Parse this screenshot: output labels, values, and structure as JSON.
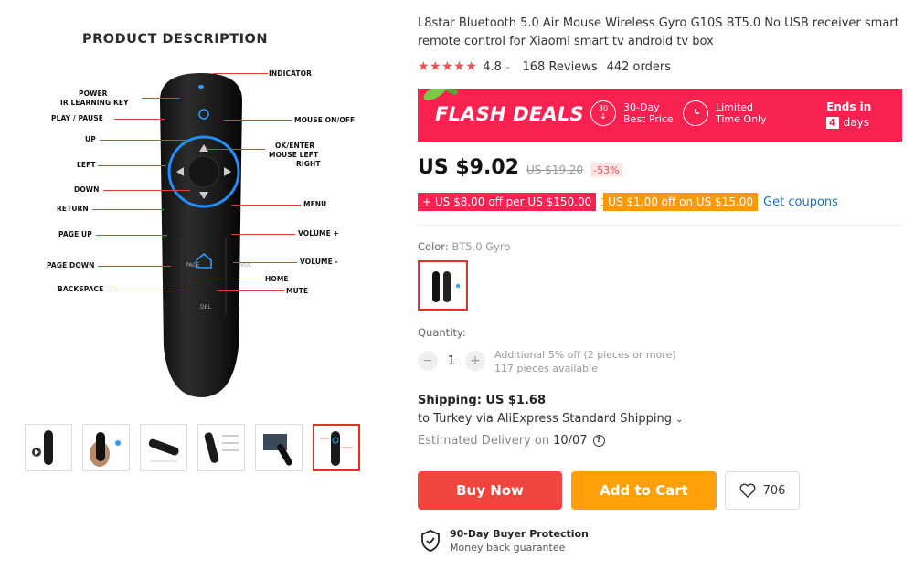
{
  "gallery": {
    "main": {
      "heading": "PRODUCT DESCRIPTION",
      "labels": {
        "power": "POWER",
        "ir_learning": "IR LEARNING KEY",
        "play_pause": "PLAY / PAUSE",
        "up": "UP",
        "left": "LEFT",
        "down": "DOWN",
        "return": "RETURN",
        "page_up": "PAGE UP",
        "page_down": "PAGE DOWN",
        "backspace": "BACKSPACE",
        "indicator": "INDICATOR",
        "mouse_onoff": "MOUSE ON/OFF",
        "ok_enter": "OK/ENTER",
        "mouse_left": "MOUSE LEFT",
        "right": "RIGHT",
        "menu": "MENU",
        "volume_plus": "VOLUME +",
        "volume_minus": "VOLUME -",
        "home": "HOME",
        "mute": "MUTE"
      },
      "remote_keys": {
        "page": "PAGE",
        "vol": "VOL",
        "del": "DEL"
      }
    },
    "thumbnails": 6,
    "active_thumbnail": 6
  },
  "product": {
    "title": "L8star Bluetooth 5.0 Air Mouse Wireless Gyro G10S BT5.0 No USB receiver smart remote control for Xiaomi smart tv android tv box",
    "stars": "★★★★★",
    "rating": "4.8",
    "reviews": "168 Reviews",
    "orders": "442 orders"
  },
  "flash": {
    "title": "FLASH DEALS",
    "badge1_num": "30",
    "badge1_line1": "30-Day",
    "badge1_line2": "Best Price",
    "badge2_line1": "Limited",
    "badge2_line2": "Time Only",
    "ends_label": "Ends in",
    "ends_num": "4",
    "ends_unit": "days"
  },
  "price": {
    "current": "US $9.02",
    "original": "US $19.20",
    "discount": "-53%"
  },
  "coupons": {
    "red": "+ US $8.00 off per US $150.00",
    "orange": "US $1.00 off on US $15.00",
    "link": "Get coupons"
  },
  "color": {
    "label": "Color:",
    "value": "BT5.0 Gyro"
  },
  "quantity": {
    "label": "Quantity:",
    "minus": "−",
    "value": "1",
    "plus": "+",
    "note1": "Additional 5% off (2 pieces or more)",
    "note2": "117 pieces available"
  },
  "shipping": {
    "title": "Shipping: US $1.68",
    "to": "to Turkey via AliExpress Standard Shipping",
    "est_label": "Estimated Delivery on",
    "est_date": "10/07",
    "help": "?"
  },
  "actions": {
    "buy": "Buy Now",
    "cart": "Add to Cart",
    "wish_count": "706"
  },
  "protection": {
    "title": "90-Day Buyer Protection",
    "subtitle": "Money back guarantee"
  },
  "colors": {
    "accent_red": "#f8214f",
    "buy_red": "#f0453e",
    "cart_orange": "#ff9f0a",
    "coupon_orange": "#ff9902",
    "link_blue": "#1a6fc4",
    "star_red": "#f24f4f"
  }
}
